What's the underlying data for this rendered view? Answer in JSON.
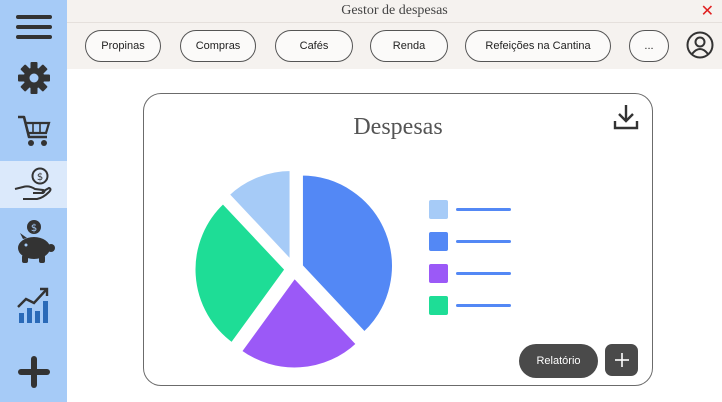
{
  "window": {
    "title": "Gestor de despesas",
    "close_glyph": "✕"
  },
  "sidebar": {
    "items": [
      {
        "icon": "menu-icon"
      },
      {
        "icon": "gear-icon"
      },
      {
        "icon": "cart-icon"
      },
      {
        "icon": "money-hand-icon",
        "active": true
      },
      {
        "icon": "piggy-bank-icon"
      },
      {
        "icon": "growth-chart-icon"
      },
      {
        "icon": "plus-icon"
      }
    ]
  },
  "tabs": [
    {
      "label": "Propinas"
    },
    {
      "label": "Compras"
    },
    {
      "label": "Cafés"
    },
    {
      "label": "Renda"
    },
    {
      "label": "Refeições na Cantina"
    },
    {
      "label": "..."
    }
  ],
  "card": {
    "title": "Despesas",
    "report_label": "Relatório"
  },
  "chart_data": {
    "type": "pie",
    "title": "Despesas",
    "series": [
      {
        "color": "#a6cbf7",
        "value": 12
      },
      {
        "color": "#5388f5",
        "value": 38
      },
      {
        "color": "#9b59f7",
        "value": 22
      },
      {
        "color": "#1edd96",
        "value": 28
      }
    ],
    "exploded": true
  },
  "colors": {
    "sidebar": "#a6cbf7",
    "sidebar_active": "#dbe9fb",
    "accent_dark": "#4a4a4a",
    "close": "#e02020"
  }
}
